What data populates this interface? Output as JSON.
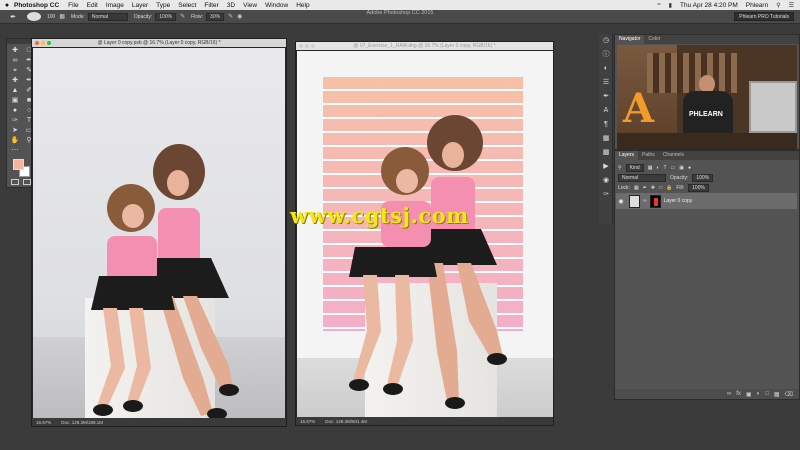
{
  "menubar": {
    "apple": "",
    "app_name": "Photoshop CC",
    "items": [
      "File",
      "Edit",
      "Image",
      "Layer",
      "Type",
      "Select",
      "Filter",
      "3D",
      "View",
      "Window",
      "Help"
    ],
    "clock": "Thu Apr 28  4:20 PM",
    "user": "Phlearn"
  },
  "options": {
    "app_title": "Adobe Photoshop CC 2015",
    "mode_label": "Mode:",
    "mode_value": "Normal",
    "opacity_label": "Opacity:",
    "opacity_value": "100%",
    "flow_label": "Flow:",
    "flow_value": "30%",
    "brush_size": "100",
    "workspace": "Phlearn PRO Tutorials"
  },
  "doc1": {
    "title": "@ Layer 0 copy.psb @ 16.7% (Layer 0 copy, RGB/16) *",
    "zoom": "16.67%",
    "doc_size": "Doc: 128.3M/189.1M"
  },
  "doc2": {
    "title": "@ 07_Exercise_1_RAW.dng @ 16.7% (Layer 0 copy, RGB/16) *",
    "zoom": "16.67%",
    "doc_size": "Doc: 128.3M/601.4M"
  },
  "navigator": {
    "tabs": [
      "Navigator",
      "Color"
    ],
    "preview_text": "PHLEARN",
    "preview_letter": "A"
  },
  "layers": {
    "tabs": [
      "Layers",
      "Paths",
      "Channels"
    ],
    "kind_label": "Kind",
    "blend_mode": "Normal",
    "opacity_label": "Opacity:",
    "opacity_value": "100%",
    "lock_label": "Lock:",
    "fill_label": "Fill:",
    "fill_value": "100%",
    "layer_name": "Layer 0 copy"
  },
  "watermark": "www.cgtsj.com",
  "colors": {
    "foreground": "#f6b39e",
    "background": "#ffffff",
    "stripe_top": "#f7c0a8",
    "stripe_bottom": "#f4aec8"
  }
}
